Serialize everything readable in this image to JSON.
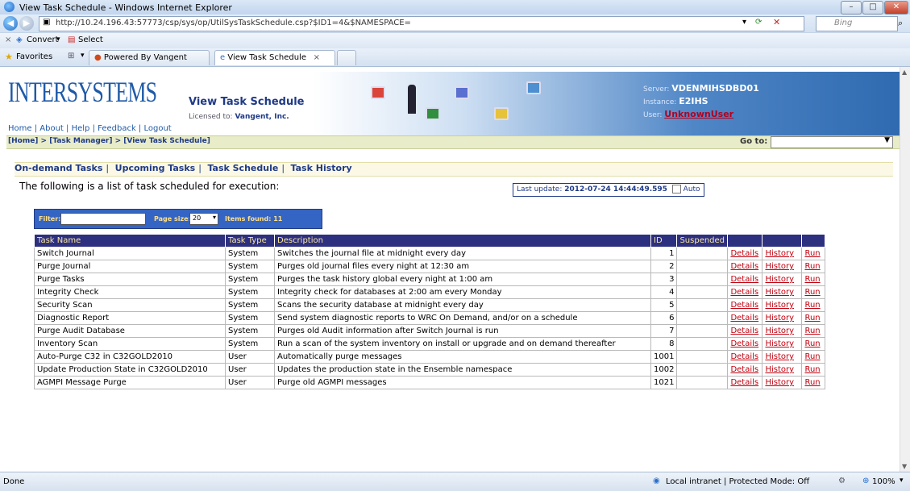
{
  "browser": {
    "title": "View Task Schedule - Windows Internet Explorer",
    "url": "http://10.24.196.43:57773/csp/sys/op/UtilSysTaskSchedule.csp?$ID1=4&$NAMESPACE=",
    "search_placeholder": "Bing",
    "cmd_convert": "Convert",
    "cmd_select": "Select",
    "favorites": "Favorites",
    "tab_powered": "Powered By Vangent",
    "tab_current": "View Task Schedule",
    "status_left": "Done",
    "status_zone": "Local intranet | Protected Mode: Off",
    "zoom": "100%"
  },
  "header": {
    "logo": "INTERSYSTEMS",
    "links": [
      "Home",
      "About",
      "Help",
      "Feedback",
      "Logout"
    ],
    "page_title": "View Task Schedule",
    "licensed_label": "Licensed to:",
    "licensed_to": "Vangent, Inc.",
    "server_label": "Server:",
    "server": "VDENMIHSDBD01",
    "instance_label": "Instance:",
    "instance": "E2IHS",
    "user_label": "User:",
    "user": "UnknownUser"
  },
  "breadcrumb": "[Home] > [Task Manager] > [View Task Schedule]",
  "goto_label": "Go to:",
  "menu": [
    "On-demand Tasks",
    "Upcoming Tasks",
    "Task Schedule",
    "Task History"
  ],
  "intro": "The following is a list of task scheduled for execution:",
  "last_update_label": "Last update:",
  "last_update": "2012-07-24 14:44:49.595",
  "auto_label": "Auto",
  "filter": {
    "filter_label": "Filter:",
    "page_size_label": "Page size:",
    "page_size": "20",
    "items_found": "Items found: 11"
  },
  "table": {
    "headers": [
      "Task Name",
      "Task Type",
      "Description",
      "ID",
      "Suspended",
      "",
      "",
      ""
    ],
    "rows": [
      [
        "Switch Journal",
        "System",
        "Switches the journal file at midnight every day",
        "1",
        "",
        "Details",
        "History",
        "Run"
      ],
      [
        "Purge Journal",
        "System",
        "Purges old journal files every night at 12:30 am",
        "2",
        "",
        "Details",
        "History",
        "Run"
      ],
      [
        "Purge Tasks",
        "System",
        "Purges the task history global every night at 1:00 am",
        "3",
        "",
        "Details",
        "History",
        "Run"
      ],
      [
        "Integrity Check",
        "System",
        "Integrity check for databases at 2:00 am every Monday",
        "4",
        "",
        "Details",
        "History",
        "Run"
      ],
      [
        "Security Scan",
        "System",
        "Scans the security database at midnight every day",
        "5",
        "",
        "Details",
        "History",
        "Run"
      ],
      [
        "Diagnostic Report",
        "System",
        "Send system diagnostic reports to WRC On Demand, and/or on a schedule",
        "6",
        "",
        "Details",
        "History",
        "Run"
      ],
      [
        "Purge Audit Database",
        "System",
        "Purges old Audit information after Switch Journal is run",
        "7",
        "",
        "Details",
        "History",
        "Run"
      ],
      [
        "Inventory Scan",
        "System",
        "Run a scan of the system inventory on install or upgrade and on demand thereafter",
        "8",
        "",
        "Details",
        "History",
        "Run"
      ],
      [
        "Auto-Purge C32 in C32GOLD2010",
        "User",
        "Automatically purge messages",
        "1001",
        "",
        "Details",
        "History",
        "Run"
      ],
      [
        "Update Production State in C32GOLD2010",
        "User",
        "Updates the production state in the Ensemble namespace",
        "1002",
        "",
        "Details",
        "History",
        "Run"
      ],
      [
        "AGMPI Message Purge",
        "User",
        "Purge old AGMPI messages",
        "1021",
        "",
        "Details",
        "History",
        "Run"
      ]
    ]
  }
}
